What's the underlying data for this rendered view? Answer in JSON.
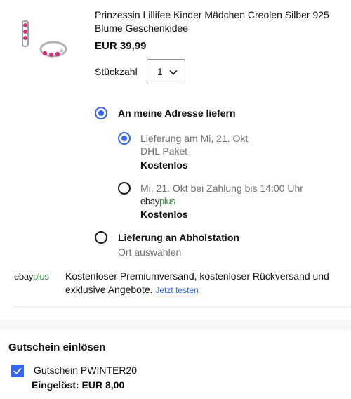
{
  "product": {
    "title": "Prinzessin Lillifee Kinder Mädchen Creolen Silber 925 Blume Geschenkidee",
    "price": "EUR 39,99",
    "quantity_label": "Stückzahl",
    "quantity_value": "1"
  },
  "delivery": {
    "home": {
      "label": "An meine Adresse liefern",
      "options": [
        {
          "line1": "Lieferung am Mi, 21. Okt",
          "line2": "DHL Paket",
          "cost": "Kostenlos"
        },
        {
          "line1": "Mi, 21. Okt bei Zahlung bis 14:00 Uhr",
          "badge_ebay": "ebay",
          "badge_plus": "plus",
          "cost": "Kostenlos"
        }
      ]
    },
    "pickup": {
      "label": "Lieferung an Abholstation",
      "sub": "Ort auswählen"
    }
  },
  "ebay_plus": {
    "logo_ebay": "ebay",
    "logo_plus": "plus",
    "text": "Kostenloser Premiumversand, kostenloser Rückversand und exklusive Angebote.",
    "link": "Jetzt testen"
  },
  "voucher": {
    "heading": "Gutschein einlösen",
    "code_label": "Gutschein PWINTER20",
    "applied": "Eingelöst: EUR 8,00"
  },
  "colors": {
    "accent": "#3665f3",
    "plus_green": "#2e8a3c"
  },
  "icons": [
    "chevron-down-icon",
    "checkmark-icon",
    "product-thumbnail"
  ]
}
